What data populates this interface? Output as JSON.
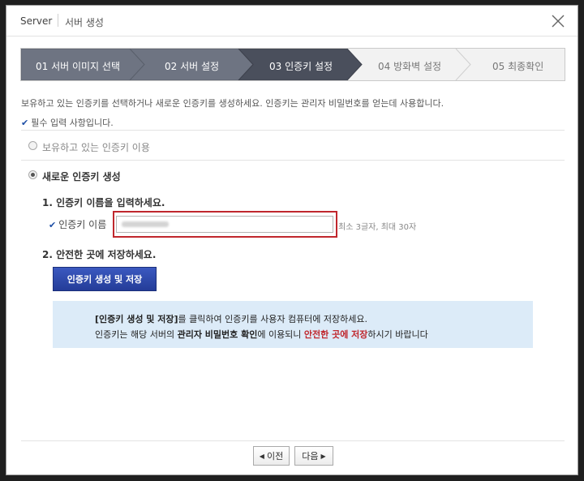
{
  "window": {
    "title": "Server",
    "subtitle": "서버 생성"
  },
  "steps": [
    {
      "label": "01 서버 이미지 선택",
      "state": "done"
    },
    {
      "label": "02 서버 설정",
      "state": "done"
    },
    {
      "label": "03 인증키 설정",
      "state": "active"
    },
    {
      "label": "04 방화벽 설정",
      "state": "todo"
    },
    {
      "label": "05 최종확인",
      "state": "todo"
    }
  ],
  "description": "보유하고 있는 인증키를 선택하거나 새로운 인증키를 생성하세요. 인증키는 관리자 비밀번호를 얻는데 사용합니다.",
  "required_note": "필수 입력 사항입니다.",
  "options": {
    "existing": "보유하고 있는 인증키 이용",
    "new": "새로운 인증키 생성",
    "selected": "new"
  },
  "step1_title": "1. 인증키 이름을 입력하세요.",
  "field": {
    "label": "인증키 이름",
    "value": "",
    "hint": "최소 3글자, 최대 30자"
  },
  "step2_title": "2. 안전한 곳에 저장하세요.",
  "generate_button": "인증키 생성 및 저장",
  "info": {
    "line1_bold": "[인증키 생성 및 저장]",
    "line1_rest": "를 클릭하여 인증키를 사용자 컴퓨터에 저장하세요.",
    "line2_a": "인증키는 해당 서버의 ",
    "line2_b": "관리자 비밀번호 확인",
    "line2_c": "에 이용되니 ",
    "line2_d": "안전한 곳에 저장",
    "line2_e": "하시기 바랍니다"
  },
  "nav": {
    "prev": "이전",
    "next": "다음"
  },
  "colors": {
    "step_active": "#4a4f5c",
    "step_done": "#6e7482",
    "step_todo": "#f2f2f2",
    "primary_button": "#2c46a6",
    "info_bg": "#dcebf8",
    "highlight": "#c0272d"
  }
}
